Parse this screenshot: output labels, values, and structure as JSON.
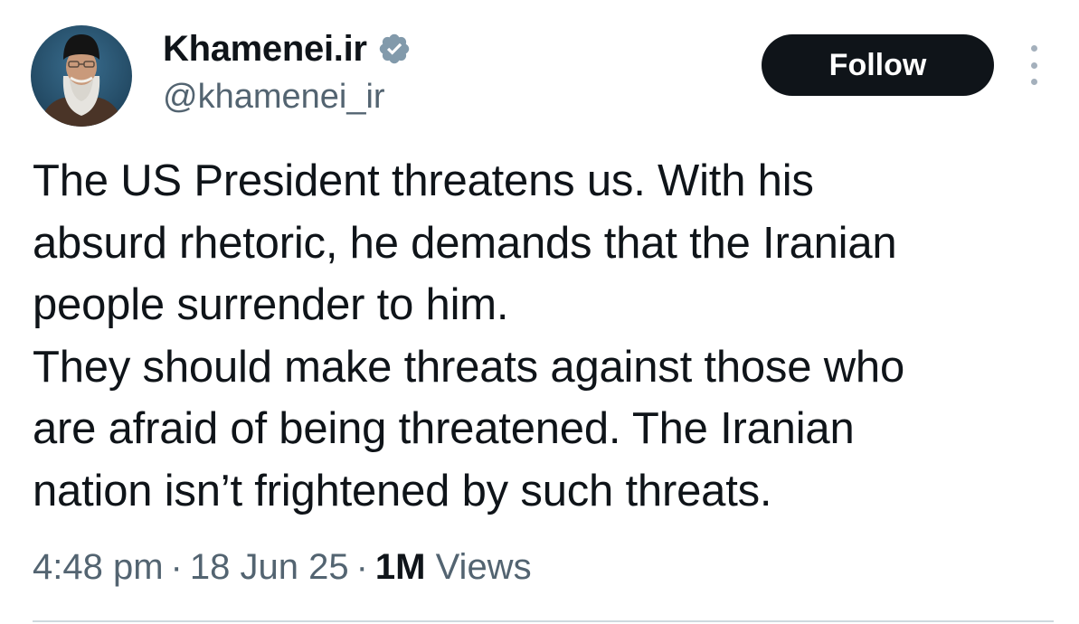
{
  "author": {
    "display_name": "Khamenei.ir",
    "handle": "@khamenei_ir",
    "verified": true,
    "verified_icon": "verified-badge-icon"
  },
  "actions": {
    "follow_label": "Follow",
    "more_icon": "more-options-icon"
  },
  "tweet": {
    "lines": [
      "The US President threatens us. With his",
      "absurd rhetoric, he demands that the Iranian",
      "people surrender to him.",
      "They should make threats against those who",
      "are afraid of being threatened. The Iranian",
      "nation isn’t frightened by such threats."
    ]
  },
  "meta": {
    "time": "4:48 pm",
    "separator": "·",
    "date": "18 Jun 25",
    "views_count": "1M",
    "views_label": "Views"
  },
  "colors": {
    "text_primary": "#0f1419",
    "text_secondary": "#536471",
    "follow_bg": "#0f1419",
    "verified_badge": "#829aab",
    "divider": "#cfd9de"
  }
}
